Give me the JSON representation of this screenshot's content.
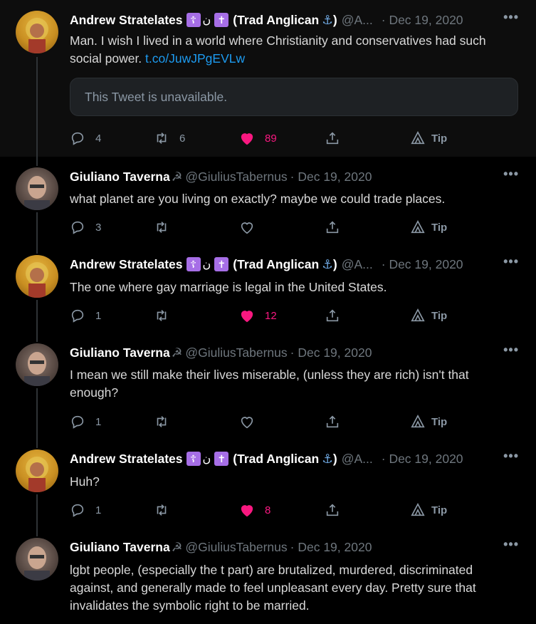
{
  "tweets": [
    {
      "name": "Andrew Stratelates",
      "name_suffix": "(Trad Anglican",
      "handle": "@A...",
      "date": "· Dec 19, 2020",
      "text": "Man. I wish I lived in a world where Christianity and conservatives had such social power.",
      "link": "t.co/JuwJPgEVLw",
      "quote": "This Tweet is unavailable.",
      "replies": "4",
      "retweets": "6",
      "likes": "89",
      "liked": true,
      "tip": "Tip"
    },
    {
      "name": "Giuliano Taverna",
      "handle": "@GiuliusTabernus",
      "date": "· Dec 19, 2020",
      "text": "what planet are you living on exactly? maybe we could trade places.",
      "replies": "3",
      "retweets": "",
      "likes": "",
      "liked": false,
      "tip": "Tip"
    },
    {
      "name": "Andrew Stratelates",
      "name_suffix": "(Trad Anglican",
      "handle": "@A...",
      "date": "· Dec 19, 2020",
      "text": "The one where gay marriage is legal in the United States.",
      "replies": "1",
      "retweets": "",
      "likes": "12",
      "liked": true,
      "tip": "Tip"
    },
    {
      "name": "Giuliano Taverna",
      "handle": "@GiuliusTabernus",
      "date": "· Dec 19, 2020",
      "text": "I mean we still make their lives miserable, (unless they are rich) isn't that enough?",
      "replies": "1",
      "retweets": "",
      "likes": "",
      "liked": false,
      "tip": "Tip"
    },
    {
      "name": "Andrew Stratelates",
      "name_suffix": "(Trad Anglican",
      "handle": "@A...",
      "date": "· Dec 19, 2020",
      "text": "Huh?",
      "replies": "1",
      "retweets": "",
      "likes": "8",
      "liked": true,
      "tip": "Tip"
    },
    {
      "name": "Giuliano Taverna",
      "handle": "@GiuliusTabernus",
      "date": "· Dec 19, 2020",
      "text": "lgbt people, (especially the t part) are brutalized, murdered, discriminated against, and generally made to feel unpleasant every day. Pretty sure that invalidates the symbolic right to be married."
    }
  ],
  "icons": {
    "more": "more-icon",
    "reply": "reply-icon",
    "retweet": "retweet-icon",
    "like": "heart-icon",
    "share": "share-icon",
    "tip": "tip-icon"
  },
  "colors": {
    "background": "#000000",
    "highlight_background": "#0d0d0d",
    "link": "#1d9bf0",
    "like": "#f91880",
    "muted": "#8b98a5"
  }
}
